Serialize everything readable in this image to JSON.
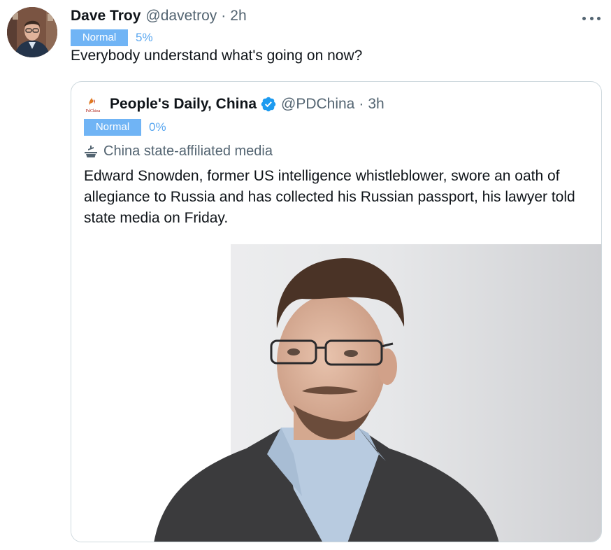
{
  "tweet": {
    "author_name": "Dave Troy",
    "handle": "@davetroy",
    "separator": "·",
    "time": "2h",
    "badge_label": "Normal",
    "badge_percent": "5%",
    "text": "Everybody understand what's going on now?",
    "more_icon": "more-icon",
    "avatar": "avatar"
  },
  "quoted": {
    "logo_text": "PdChina",
    "author_name": "People's Daily, China",
    "verified_icon": "verified-badge-icon",
    "handle": "@PDChina",
    "separator": "·",
    "time": "3h",
    "badge_label": "Normal",
    "badge_percent": "0%",
    "affiliation_icon": "podium-icon",
    "affiliation": "China state-affiliated media",
    "text": "Edward Snowden, former US intelligence whistleblower, swore an oath of allegiance to Russia and has collected his Russian passport, his lawyer told state media on Friday.",
    "media": "photo"
  },
  "colors": {
    "text_primary": "#0f1419",
    "text_secondary": "#536471",
    "badge_bg": "#70b4f5",
    "percent": "#5aa7f0",
    "verified": "#1d9bf0",
    "border": "#cfd9de"
  }
}
